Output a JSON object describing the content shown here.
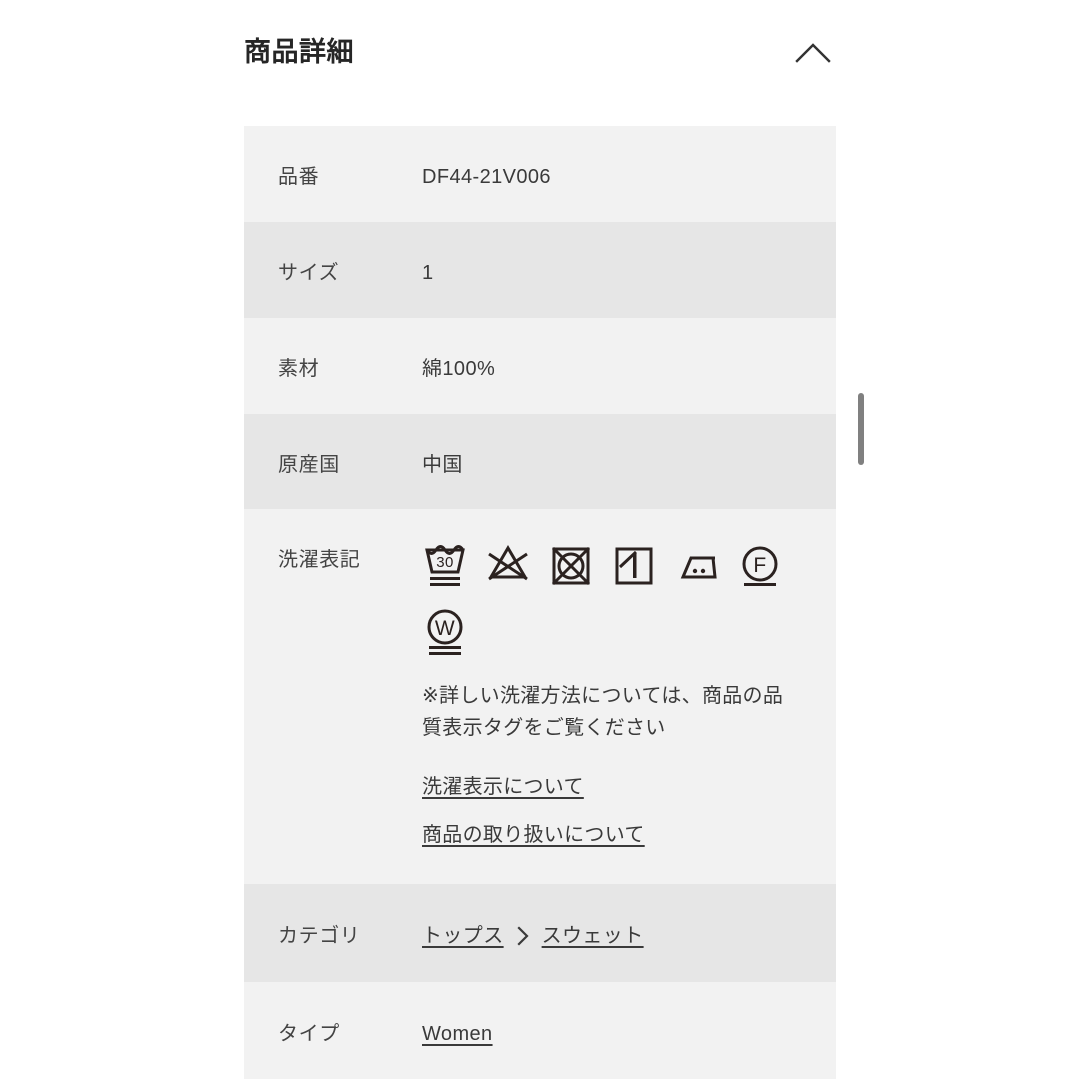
{
  "panel": {
    "title": "商品詳細",
    "collapse_icon": "chevron-up-icon"
  },
  "rows": {
    "product_no": {
      "label": "品番",
      "value": "DF44-21V006"
    },
    "size": {
      "label": "サイズ",
      "value": "1"
    },
    "material": {
      "label": "素材",
      "value": "綿100%"
    },
    "origin": {
      "label": "原産国",
      "value": "中国"
    },
    "care": {
      "label": "洗濯表記",
      "note": "※詳しい洗濯方法については、商品の品質表示タグをご覧ください",
      "symbols": [
        {
          "name": "wash-30-very-delicate-icon",
          "temperature": "30"
        },
        {
          "name": "do-not-bleach-icon"
        },
        {
          "name": "do-not-tumble-dry-icon"
        },
        {
          "name": "line-dry-in-shade-icon"
        },
        {
          "name": "iron-medium-heat-icon"
        },
        {
          "name": "petroleum-dry-clean-gentle-icon",
          "letter": "F"
        },
        {
          "name": "wet-clean-very-gentle-icon",
          "letter": "W"
        }
      ],
      "links": [
        {
          "label": "洗濯表示について"
        },
        {
          "label": "商品の取り扱いについて"
        }
      ]
    },
    "category": {
      "label": "カテゴリ",
      "crumbs": [
        {
          "label": "トップス"
        },
        {
          "label": "スウェット"
        }
      ],
      "separator_icon": "chevron-right-icon"
    },
    "type": {
      "label": "タイプ",
      "value": "Women"
    }
  },
  "colors": {
    "row_light": "#f2f2f2",
    "row_shade": "#e6e6e6",
    "text": "#3a3a3a",
    "title": "#262626",
    "symbol": "#2b2220",
    "scrollbar": "#808080"
  }
}
